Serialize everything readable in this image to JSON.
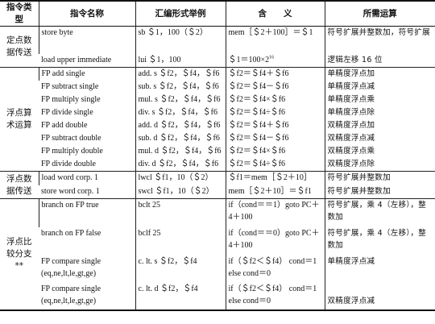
{
  "headers": [
    "指令类型",
    "指令名称",
    "汇编形式举例",
    "含　　义",
    "所需运算"
  ],
  "groups": [
    {
      "category": "定点数据传送",
      "rows": [
        {
          "name": "store byte",
          "example": "sb ＄1，100（＄2）",
          "meaning": "mem［＄2＋100］＝＄1",
          "ops": "符号扩展并整数加，符号扩展"
        },
        {
          "name": "load upper immediate",
          "example": "lui ＄1，100",
          "meaning_base": "＄1＝100×2",
          "meaning_sup": "16",
          "ops": "逻辑左移 16 位"
        }
      ]
    },
    {
      "category": "浮点算术运算",
      "rows": [
        {
          "name": "FP add single",
          "example": "add. s ＄f2，＄f4，＄f6",
          "meaning": "＄f2＝＄f4＋＄f6",
          "ops": "单精度浮点加"
        },
        {
          "name": "FP subtract single",
          "example": "sub. s ＄f2，＄f4，＄f6",
          "meaning": "＄f2＝＄f4－＄f6",
          "ops": "单精度浮点减"
        },
        {
          "name": "FP multiply single",
          "example": "mul. s ＄f2，＄f4，＄f6",
          "meaning": "＄f2＝＄f4×＄f6",
          "ops": "单精度浮点乘"
        },
        {
          "name": "FP divide single",
          "example": "div. s ＄f2，＄f4，＄f6",
          "meaning": "＄f2＝＄f4÷＄f6",
          "ops": "单精度浮点除"
        },
        {
          "name": "FP add double",
          "example": "add. d ＄f2，＄f4，＄f6",
          "meaning": "＄f2＝＄f4＋＄f6",
          "ops": "双精度浮点加"
        },
        {
          "name": "FP subtract double",
          "example": "sub. d ＄f2，＄f4，＄f6",
          "meaning": "＄f2＝＄f4－＄f6",
          "ops": "双精度浮点减"
        },
        {
          "name": "FP multiply double",
          "example": "mul. d ＄f2，＄f4，＄f6",
          "meaning": "＄f2＝＄f4×＄f6",
          "ops": "双精度浮点乘"
        },
        {
          "name": "FP divide double",
          "example": "div. d ＄f2，＄f4，＄f6",
          "meaning": "＄f2＝＄f4÷＄f6",
          "ops": "双精度浮点除"
        }
      ]
    },
    {
      "category": "浮点数据传送",
      "rows": [
        {
          "name": "load word corp. 1",
          "example": "lwcl ＄f1，10（＄2）",
          "meaning": "＄f1＝mem［＄2＋10］",
          "ops": "符号扩展并整数加"
        },
        {
          "name": "store word corp. 1",
          "example": "swcl ＄f1，10（＄2）",
          "meaning": "mem［＄2＋10］＝＄f1",
          "ops": "符号扩展并整数加"
        }
      ]
    },
    {
      "category": "浮点比较分支**",
      "rows": [
        {
          "name": "branch on FP true",
          "example": "bclt 25",
          "meaning": "if（cond＝＝1）goto PC＋4＋100",
          "ops": "符号扩展，乘 4（左移），整数加"
        },
        {
          "name": "branch on FP false",
          "example": "bclf 25",
          "meaning": "if（cond＝＝0）goto PC＋4＋100",
          "ops": "符号扩展，乘 4（左移），整数加"
        },
        {
          "name": "FP compare single (eq,ne,lt,le,gt,ge)",
          "example": "c. lt. s ＄f2，＄f4",
          "meaning": "if（＄f2＜＄f4） cond＝1 else cond＝0",
          "ops": "单精度浮点减"
        },
        {
          "name": "FP compare single (eq,ne,lt,le,gt,ge)",
          "example": "c. lt. d ＄f2，＄f4",
          "meaning": "if（＄f2＜＄f4） cond＝1 else cond＝0",
          "ops": "双精度浮点减"
        }
      ]
    }
  ]
}
